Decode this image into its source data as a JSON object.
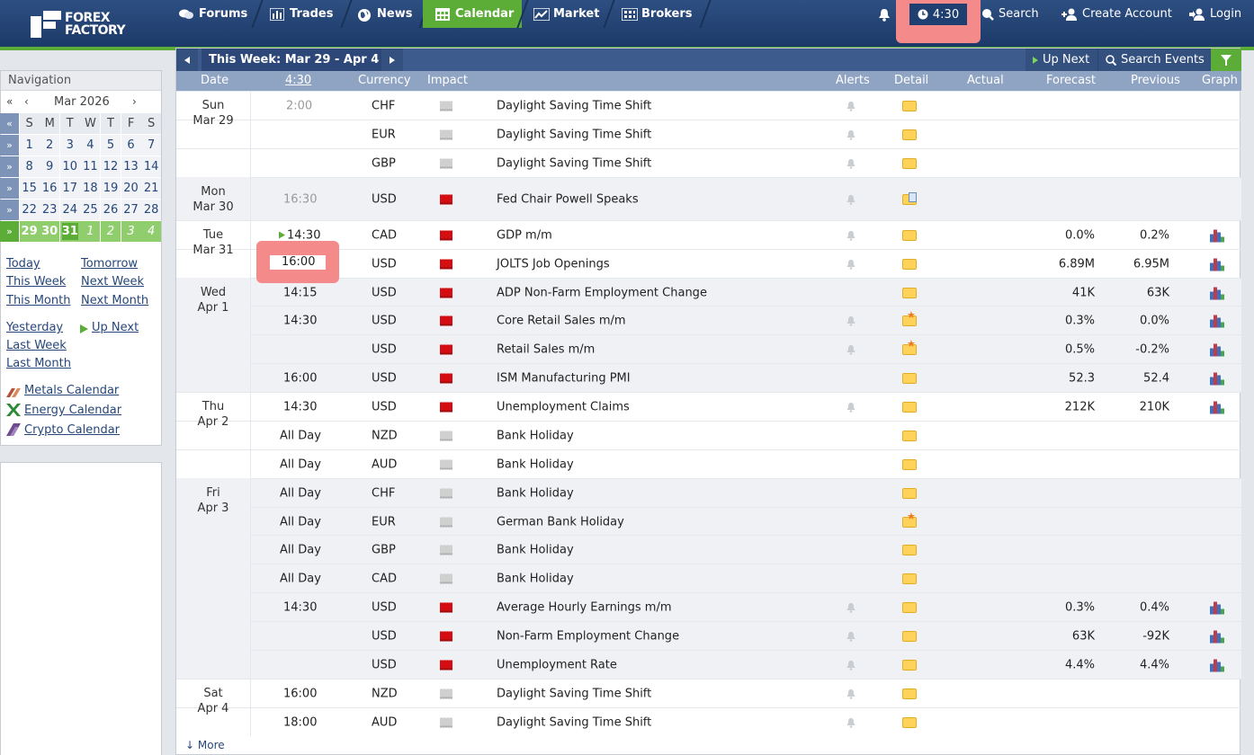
{
  "app": {
    "brand_line1": "FOREX",
    "brand_line2": "FACTORY"
  },
  "nav": {
    "forums": "Forums",
    "trades": "Trades",
    "news": "News",
    "calendar": "Calendar",
    "market": "Market",
    "brokers": "Brokers"
  },
  "right_nav": {
    "clock": "4:30",
    "search": "Search",
    "create_account": "Create Account",
    "login": "Login"
  },
  "sidebar": {
    "title": "Navigation",
    "month_label": "Mar 2026",
    "day_headers": [
      "S",
      "M",
      "T",
      "W",
      "T",
      "F",
      "S"
    ],
    "weeks": [
      [
        "1",
        "2",
        "3",
        "4",
        "5",
        "6",
        "7"
      ],
      [
        "8",
        "9",
        "10",
        "11",
        "12",
        "13",
        "14"
      ],
      [
        "15",
        "16",
        "17",
        "18",
        "19",
        "20",
        "21"
      ],
      [
        "22",
        "23",
        "24",
        "25",
        "26",
        "27",
        "28"
      ],
      [
        "29",
        "30",
        "31",
        "1",
        "2",
        "3",
        "4"
      ]
    ],
    "links": {
      "today": "Today",
      "tomorrow": "Tomorrow",
      "this_week": "This Week",
      "next_week": "Next Week",
      "this_month": "This Month",
      "next_month": "Next Month",
      "yesterday": "Yesterday",
      "up_next": "Up Next",
      "last_week": "Last Week",
      "last_month": "Last Month",
      "metals": "Metals Calendar",
      "energy": "Energy Calendar",
      "crypto": "Crypto Calendar"
    }
  },
  "calendar": {
    "week_label": "This Week: Mar 29 - Apr 4",
    "up_next": "Up Next",
    "search_events": "Search Events",
    "columns": {
      "date": "Date",
      "time": "4:30",
      "currency": "Currency",
      "impact": "Impact",
      "alerts": "Alerts",
      "detail": "Detail",
      "actual": "Actual",
      "forecast": "Forecast",
      "previous": "Previous",
      "graph": "Graph"
    },
    "days": [
      {
        "dow": "Sun",
        "date": "Mar 29"
      },
      {
        "dow": "Mon",
        "date": "Mar 30"
      },
      {
        "dow": "Tue",
        "date": "Mar 31"
      },
      {
        "dow": "Wed",
        "date": "Apr 1"
      },
      {
        "dow": "Thu",
        "date": "Apr 2"
      },
      {
        "dow": "Fri",
        "date": "Apr 3"
      },
      {
        "dow": "Sat",
        "date": "Apr 4"
      }
    ],
    "events": [
      {
        "time": "2:00",
        "currency": "CHF",
        "impact": "gray",
        "name": "Daylight Saving Time Shift",
        "forecast": "",
        "previous": ""
      },
      {
        "time": "",
        "currency": "EUR",
        "impact": "gray",
        "name": "Daylight Saving Time Shift",
        "forecast": "",
        "previous": ""
      },
      {
        "time": "",
        "currency": "GBP",
        "impact": "gray",
        "name": "Daylight Saving Time Shift",
        "forecast": "",
        "previous": ""
      },
      {
        "time": "16:30",
        "currency": "USD",
        "impact": "red",
        "name": "Fed Chair Powell Speaks",
        "forecast": "",
        "previous": ""
      },
      {
        "time": "14:30",
        "currency": "CAD",
        "impact": "red",
        "name": "GDP m/m",
        "forecast": "0.0%",
        "previous": "0.2%"
      },
      {
        "time": "16:00",
        "currency": "USD",
        "impact": "red",
        "name": "JOLTS Job Openings",
        "forecast": "6.89M",
        "previous": "6.95M"
      },
      {
        "time": "14:15",
        "currency": "USD",
        "impact": "red",
        "name": "ADP Non-Farm Employment Change",
        "forecast": "41K",
        "previous": "63K"
      },
      {
        "time": "14:30",
        "currency": "USD",
        "impact": "red",
        "name": "Core Retail Sales m/m",
        "forecast": "0.3%",
        "previous": "0.0%"
      },
      {
        "time": "",
        "currency": "USD",
        "impact": "red",
        "name": "Retail Sales m/m",
        "forecast": "0.5%",
        "previous": "-0.2%"
      },
      {
        "time": "16:00",
        "currency": "USD",
        "impact": "red",
        "name": "ISM Manufacturing PMI",
        "forecast": "52.3",
        "previous": "52.4"
      },
      {
        "time": "14:30",
        "currency": "USD",
        "impact": "red",
        "name": "Unemployment Claims",
        "forecast": "212K",
        "previous": "210K"
      },
      {
        "time": "All Day",
        "currency": "NZD",
        "impact": "gray",
        "name": "Bank Holiday",
        "forecast": "",
        "previous": ""
      },
      {
        "time": "All Day",
        "currency": "AUD",
        "impact": "gray",
        "name": "Bank Holiday",
        "forecast": "",
        "previous": ""
      },
      {
        "time": "All Day",
        "currency": "CHF",
        "impact": "gray",
        "name": "Bank Holiday",
        "forecast": "",
        "previous": ""
      },
      {
        "time": "All Day",
        "currency": "EUR",
        "impact": "gray",
        "name": "German Bank Holiday",
        "forecast": "",
        "previous": ""
      },
      {
        "time": "All Day",
        "currency": "GBP",
        "impact": "gray",
        "name": "Bank Holiday",
        "forecast": "",
        "previous": ""
      },
      {
        "time": "All Day",
        "currency": "CAD",
        "impact": "gray",
        "name": "Bank Holiday",
        "forecast": "",
        "previous": ""
      },
      {
        "time": "14:30",
        "currency": "USD",
        "impact": "red",
        "name": "Average Hourly Earnings m/m",
        "forecast": "0.3%",
        "previous": "0.4%"
      },
      {
        "time": "",
        "currency": "USD",
        "impact": "red",
        "name": "Non-Farm Employment Change",
        "forecast": "63K",
        "previous": "-92K"
      },
      {
        "time": "",
        "currency": "USD",
        "impact": "red",
        "name": "Unemployment Rate",
        "forecast": "4.4%",
        "previous": "4.4%"
      },
      {
        "time": "16:00",
        "currency": "NZD",
        "impact": "gray",
        "name": "Daylight Saving Time Shift",
        "forecast": "",
        "previous": ""
      },
      {
        "time": "18:00",
        "currency": "AUD",
        "impact": "gray",
        "name": "Daylight Saving Time Shift",
        "forecast": "",
        "previous": ""
      }
    ],
    "more": "More"
  }
}
